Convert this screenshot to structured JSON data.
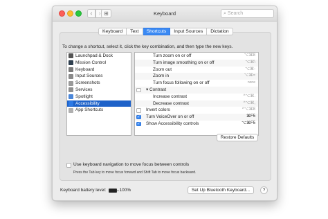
{
  "window": {
    "title": "Keyboard",
    "search_placeholder": "Search"
  },
  "icons": {
    "search": "magnifier-icon",
    "back": "chevron-left-icon",
    "forward": "chevron-right-icon",
    "grid": "grid-icon"
  },
  "tabs": [
    {
      "label": "Keyboard",
      "active": false
    },
    {
      "label": "Text",
      "active": false
    },
    {
      "label": "Shortcuts",
      "active": true
    },
    {
      "label": "Input Sources",
      "active": false
    },
    {
      "label": "Dictation",
      "active": false
    }
  ],
  "instructions": "To change a shortcut, select it, click the key combination, and then type the new keys.",
  "categories": [
    {
      "label": "Launchpad & Dock",
      "icon": "launchpad-icon",
      "color": "#555555"
    },
    {
      "label": "Mission Control",
      "icon": "mission-control-icon",
      "color": "#2f3f4f"
    },
    {
      "label": "Keyboard",
      "icon": "keyboard-icon",
      "color": "#7a7a7a"
    },
    {
      "label": "Input Sources",
      "icon": "input-sources-icon",
      "color": "#8a8a8a"
    },
    {
      "label": "Screenshots",
      "icon": "screenshots-icon",
      "color": "#9a9a9a"
    },
    {
      "label": "Services",
      "icon": "services-icon",
      "color": "#8f8f8f"
    },
    {
      "label": "Spotlight",
      "icon": "spotlight-icon",
      "color": "#4b86d8"
    },
    {
      "label": "Accessibility",
      "icon": "accessibility-icon",
      "color": "#2d7ae6",
      "selected": true
    },
    {
      "label": "App Shortcuts",
      "icon": "app-shortcuts-icon",
      "color": "#b0b0b0"
    }
  ],
  "shortcuts": [
    {
      "name": "Turn zoom on or off",
      "key": "⌥⌘8",
      "checkbox": false,
      "indent": 1,
      "dark": false
    },
    {
      "name": "Turn image smoothing on or off",
      "key": "⌥⌘\\",
      "checkbox": false,
      "indent": 1,
      "dark": false
    },
    {
      "name": "Zoom out",
      "key": "⌥⌘-",
      "checkbox": false,
      "indent": 1,
      "dark": false
    },
    {
      "name": "Zoom in",
      "key": "⌥⌘=",
      "checkbox": false,
      "indent": 1,
      "dark": false
    },
    {
      "name": "Turn focus following on or off",
      "key": "none",
      "checkbox": false,
      "indent": 1,
      "dark": false,
      "small": true
    },
    {
      "name": "▾ Contrast",
      "key": "",
      "checkbox": true,
      "checked": false,
      "indent": 0,
      "dark": false
    },
    {
      "name": "Increase contrast",
      "key": "^⌥⌘.",
      "checkbox": false,
      "indent": 1,
      "dark": false
    },
    {
      "name": "Decrease contrast",
      "key": "^⌥⌘,",
      "checkbox": false,
      "indent": 1,
      "dark": false
    },
    {
      "name": "Invert colors",
      "key": "^⌥⌘8",
      "checkbox": true,
      "checked": false,
      "indent": 0,
      "dark": false
    },
    {
      "name": "Turn VoiceOver on or off",
      "key": "⌘F5",
      "checkbox": true,
      "checked": true,
      "indent": 0,
      "dark": true
    },
    {
      "name": "Show Accessibility controls",
      "key": "⌥⌘F5",
      "checkbox": true,
      "checked": true,
      "indent": 0,
      "dark": true
    }
  ],
  "restore_label": "Restore Defaults",
  "kbnav": {
    "label": "Use keyboard navigation to move focus between controls",
    "hint": "Press the Tab key to move focus forward and Shift Tab to move focus backward.",
    "checked": false
  },
  "battery": {
    "label": "Keyboard battery level:",
    "value": "100%"
  },
  "bluetooth_button": "Set Up Bluetooth Keyboard...",
  "help_label": "?"
}
